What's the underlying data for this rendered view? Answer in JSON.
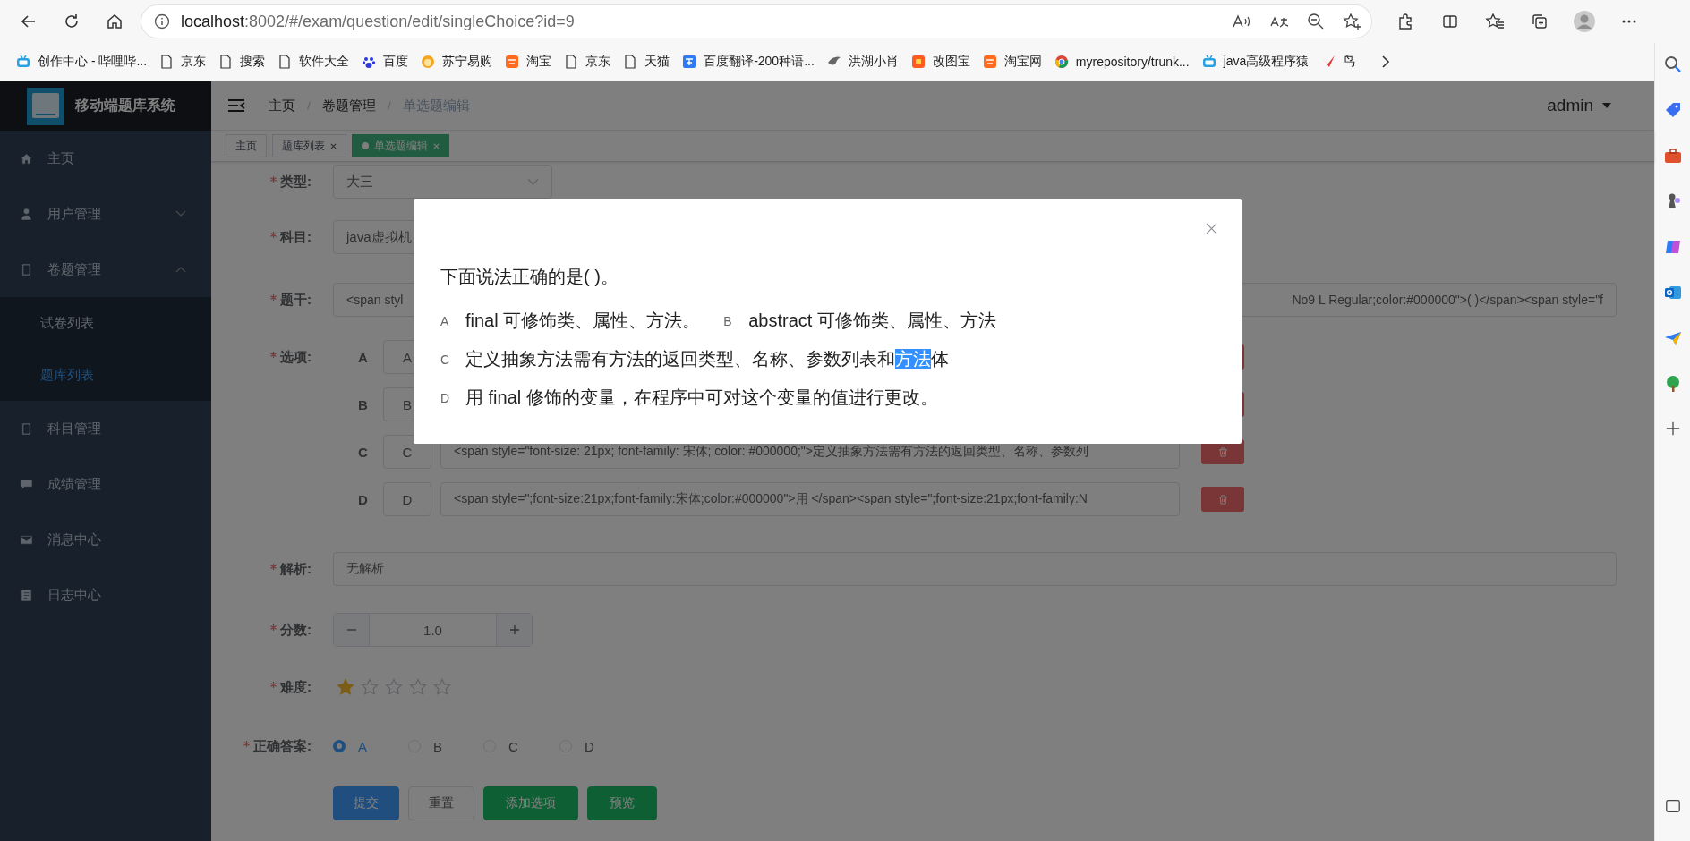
{
  "browser": {
    "url": {
      "host": "localhost",
      "rest": ":8002/#/exam/question/edit/singleChoice?id=9"
    },
    "bookmarks": [
      {
        "label": "创作中心 - 哔哩哔...",
        "kind": "tv"
      },
      {
        "label": "京东",
        "kind": "page"
      },
      {
        "label": "搜索",
        "kind": "page"
      },
      {
        "label": "软件大全",
        "kind": "page"
      },
      {
        "label": "百度",
        "kind": "paw"
      },
      {
        "label": "苏宁易购",
        "kind": "face"
      },
      {
        "label": "淘宝",
        "kind": "tao"
      },
      {
        "label": "京东",
        "kind": "page"
      },
      {
        "label": "天猫",
        "kind": "page"
      },
      {
        "label": "百度翻译-200种语...",
        "kind": "translate"
      },
      {
        "label": "洪湖小肖",
        "kind": "bird"
      },
      {
        "label": "改图宝",
        "kind": "square"
      },
      {
        "label": "淘宝网",
        "kind": "tao"
      },
      {
        "label": "myrepository/trunk...",
        "kind": "globe"
      },
      {
        "label": "java高级程序猿",
        "kind": "tv"
      },
      {
        "label": "鸟",
        "kind": "redbird"
      }
    ]
  },
  "app": {
    "title": "移动端题库系统",
    "user": "admin"
  },
  "breadcrumb": [
    "主页",
    "卷题管理",
    "单选题编辑"
  ],
  "tags": [
    {
      "label": "主页",
      "closable": false,
      "selected": false
    },
    {
      "label": "题库列表",
      "closable": true,
      "selected": false
    },
    {
      "label": "单选题编辑",
      "closable": true,
      "selected": true
    }
  ],
  "sidebar": {
    "items": [
      {
        "label": "主页"
      },
      {
        "label": "用户管理",
        "expanded": false
      },
      {
        "label": "卷题管理",
        "expanded": true,
        "children": [
          {
            "label": "试卷列表",
            "selected": false
          },
          {
            "label": "题库列表",
            "selected": true
          }
        ]
      },
      {
        "label": "科目管理"
      },
      {
        "label": "成绩管理"
      },
      {
        "label": "消息中心"
      },
      {
        "label": "日志中心"
      }
    ]
  },
  "form": {
    "type": {
      "label": "类型:",
      "required": true,
      "value": "大三"
    },
    "subject": {
      "label": "科目:",
      "required": true,
      "value": "java虚拟机"
    },
    "stem": {
      "label": "题干:",
      "required": true,
      "value_start": "<span styl",
      "value_end": "No9 L Regular;color:#000000\">( )</span><span style=\"f"
    },
    "options": {
      "label": "选项:",
      "required": true,
      "items": [
        {
          "letter": "A",
          "key": "A"
        },
        {
          "letter": "B",
          "key": "B"
        },
        {
          "letter": "C",
          "key": "C",
          "value": "<span style=\"font-size: 21px; font-family: 宋体; color: #000000;\">定义抽象方法需有方法的返回类型、名称、参数列"
        },
        {
          "letter": "D",
          "key": "D",
          "value": "<span style=\";font-size:21px;font-family:宋体;color:#000000\">用 </span><span style=\";font-size:21px;font-family:N"
        }
      ]
    },
    "analysis": {
      "label": "解析:",
      "required": true,
      "value": "无解析"
    },
    "score": {
      "label": "分数:",
      "required": true,
      "value": "1.0"
    },
    "difficulty": {
      "label": "难度:",
      "required": true,
      "stars": 1
    },
    "answer": {
      "label": "正确答案:",
      "required": true,
      "choices": [
        {
          "label": "A",
          "selected": true
        },
        {
          "label": "B",
          "selected": false
        },
        {
          "label": "C",
          "selected": false
        },
        {
          "label": "D",
          "selected": false
        }
      ]
    },
    "buttons": [
      {
        "label": "提交",
        "kind": "primary"
      },
      {
        "label": "重置",
        "kind": "default"
      },
      {
        "label": "添加选项",
        "kind": "success"
      },
      {
        "label": "预览",
        "kind": "success"
      }
    ]
  },
  "preview": {
    "question": "下面说法正确的是( )。",
    "lines": [
      [
        {
          "letter": "A",
          "text": "final 可修饰类、属性、方法。"
        },
        {
          "letter": "B",
          "text": "abstract 可修饰类、属性、方法"
        }
      ],
      [
        {
          "letter": "C",
          "text": "定义抽象方法需有方法的返回类型、名称、参数列表和",
          "highlight": "方法",
          "text_after": "体"
        }
      ],
      [
        {
          "letter": "D",
          "text": "用  final 修饰的变量，在程序中可对这个变量的值进行更改。"
        }
      ]
    ]
  }
}
